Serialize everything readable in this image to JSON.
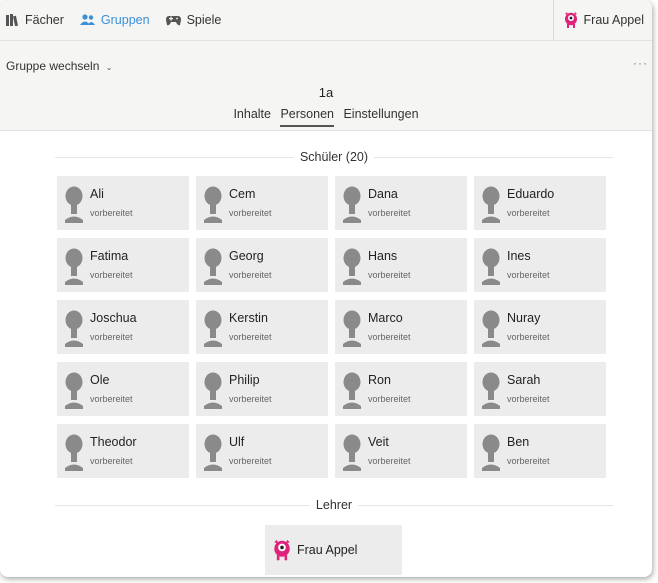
{
  "nav": {
    "items": [
      {
        "label": "Fächer",
        "icon": "books-icon"
      },
      {
        "label": "Gruppen",
        "icon": "group-icon",
        "active": true
      },
      {
        "label": "Spiele",
        "icon": "gamepad-icon"
      }
    ],
    "user": "Frau Appel"
  },
  "subheader": {
    "switch_label": "Gruppe wechseln",
    "more": "···",
    "group_name": "1a",
    "tabs": [
      "Inhalte",
      "Personen",
      "Einstellungen"
    ],
    "active_tab": "Personen"
  },
  "students": {
    "heading": "Schüler (20)",
    "items": [
      {
        "name": "Ali",
        "status": "vorbereitet"
      },
      {
        "name": "Cem",
        "status": "vorbereitet"
      },
      {
        "name": "Dana",
        "status": "vorbereitet"
      },
      {
        "name": "Eduardo",
        "status": "vorbereitet"
      },
      {
        "name": "Fatima",
        "status": "vorbereitet"
      },
      {
        "name": "Georg",
        "status": "vorbereitet"
      },
      {
        "name": "Hans",
        "status": "vorbereitet"
      },
      {
        "name": "Ines",
        "status": "vorbereitet"
      },
      {
        "name": "Joschua",
        "status": "vorbereitet"
      },
      {
        "name": "Kerstin",
        "status": "vorbereitet"
      },
      {
        "name": "Marco",
        "status": "vorbereitet"
      },
      {
        "name": "Nuray",
        "status": "vorbereitet"
      },
      {
        "name": "Ole",
        "status": "vorbereitet"
      },
      {
        "name": "Philip",
        "status": "vorbereitet"
      },
      {
        "name": "Ron",
        "status": "vorbereitet"
      },
      {
        "name": "Sarah",
        "status": "vorbereitet"
      },
      {
        "name": "Theodor",
        "status": "vorbereitet"
      },
      {
        "name": "Ulf",
        "status": "vorbereitet"
      },
      {
        "name": "Veit",
        "status": "vorbereitet"
      },
      {
        "name": "Ben",
        "status": "vorbereitet"
      }
    ]
  },
  "teachers": {
    "heading": "Lehrer",
    "items": [
      {
        "name": "Frau Appel"
      }
    ]
  },
  "colors": {
    "accent": "#3a8fd9",
    "avatar_gray": "#8a8a8a",
    "monster_pink": "#e0237a"
  }
}
